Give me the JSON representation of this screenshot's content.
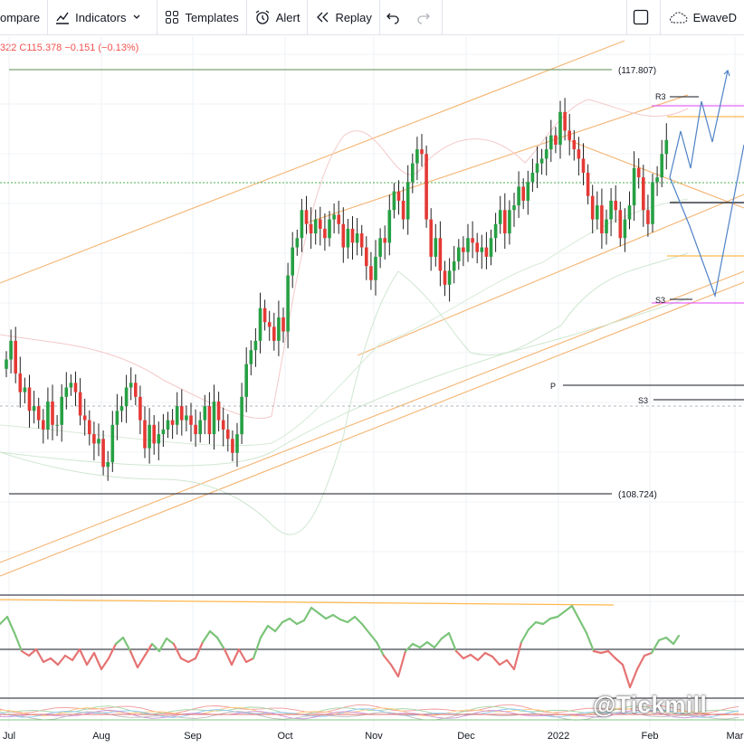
{
  "toolbar": {
    "compare_label": "ompare",
    "indicators_label": "Indicators",
    "templates_label": "Templates",
    "alert_label": "Alert",
    "replay_label": "Replay",
    "ewave_label": "EwaveD"
  },
  "legend": {
    "ohlc_text": "322  C115.378  −0.151 (−0.13%)"
  },
  "watermark": "@Tickmill",
  "colors": {
    "up": "#26a043",
    "down": "#e53935",
    "channel": "#f5b87a",
    "pivot_pink": "#e040fb"
  },
  "chart_data": {
    "type": "candlestick",
    "x_ticks": [
      "Jul",
      "Aug",
      "Sep",
      "Oct",
      "Nov",
      "Dec",
      "2022",
      "Feb",
      "Mar"
    ],
    "ylim": [
      107.2,
      118.2
    ],
    "price_labels": [
      {
        "text": "(117.807)",
        "value": 117.807
      },
      {
        "text": "(108.724)",
        "value": 108.724
      }
    ],
    "pivot_labels": [
      "R3",
      "S3",
      "P",
      "S3"
    ],
    "series": [
      {
        "values": [
          111.6,
          112.0,
          111.3,
          110.9,
          111.0,
          110.5,
          110.6,
          110.3,
          110.1,
          110.7,
          110.2,
          110.2,
          110.8,
          111.0,
          111.1,
          110.9,
          110.4,
          110.3,
          110.0,
          109.8,
          109.9,
          109.3,
          109.4,
          110.2,
          110.5,
          110.6,
          111.0,
          111.1,
          110.8,
          110.3,
          109.7,
          110.2,
          109.8,
          110.0,
          110.1,
          110.3,
          110.2,
          110.6,
          110.3,
          110.4,
          110.2,
          110.0,
          110.3,
          110.6,
          110.0,
          110.7,
          110.3,
          110.1,
          109.9,
          109.6,
          110.0,
          110.8,
          111.5,
          111.8,
          112.0,
          112.7,
          112.4,
          112.3,
          112.0,
          112.5,
          112.2,
          113.4,
          114.0,
          114.2,
          114.8,
          114.5,
          114.3,
          114.6,
          114.4,
          114.2,
          114.6,
          114.7,
          114.5,
          114.0,
          114.4,
          114.1,
          114.3,
          114.0,
          113.6,
          113.3,
          113.8,
          114.2,
          114.1,
          114.8,
          115.2,
          115.0,
          114.6,
          115.4,
          115.8,
          116.1,
          116.0,
          114.6,
          113.8,
          114.2,
          113.5,
          113.2,
          113.5,
          113.7,
          114.0,
          113.9,
          114.2,
          114.1,
          113.9,
          114.0,
          113.8,
          114.2,
          114.5,
          114.8,
          114.3,
          114.8,
          114.9,
          115.3,
          115.0,
          115.4,
          115.6,
          115.8,
          115.9,
          116.1,
          116.4,
          116.2,
          116.9,
          116.5,
          116.3,
          116.1,
          115.9,
          115.6,
          115.1,
          114.6,
          114.9,
          114.3,
          114.6,
          115.0,
          114.8,
          114.2,
          114.6,
          114.9,
          115.7,
          115.5,
          114.8,
          114.5,
          115.4,
          115.5,
          116.0,
          116.3
        ],
        "name": "",
        "ohlc_note": "close values per bar"
      }
    ]
  }
}
